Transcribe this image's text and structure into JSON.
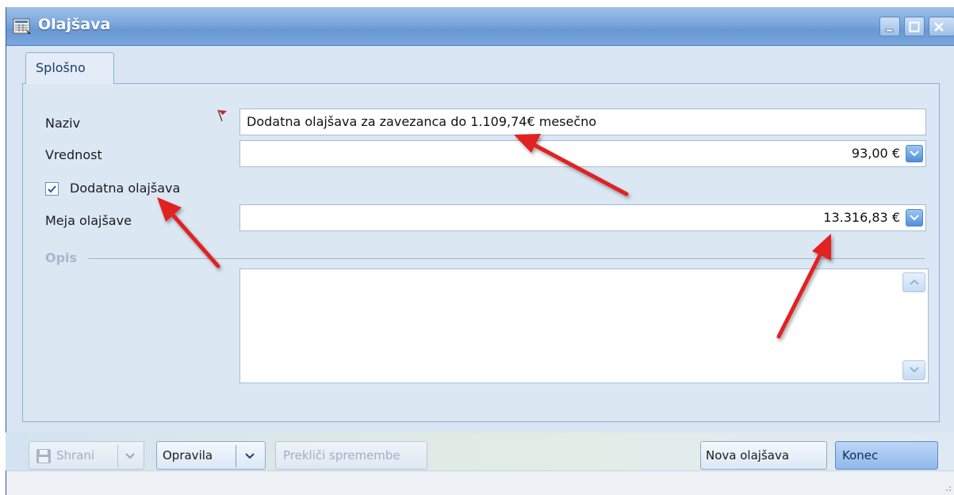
{
  "window": {
    "title": "Olajšava",
    "icon": "form-icon"
  },
  "tabs": [
    {
      "label": "Splošno",
      "active": true
    }
  ],
  "form": {
    "naziv_label": "Naziv",
    "naziv_value": "Dodatna olajšava za zavezanca do 1.109,74€ mesečno",
    "vrednost_label": "Vrednost",
    "vrednost_value": "93,00 €",
    "dodatna_label": "Dodatna olajšava",
    "dodatna_checked": true,
    "meja_label": "Meja olajšave",
    "meja_value": "13.316,83 €",
    "opis_label": "Opis",
    "opis_value": ""
  },
  "toolbar": {
    "save_label": "Shrani",
    "tasks_label": "Opravila",
    "cancel_changes_label": "Prekliči spremembe",
    "new_label": "Nova olajšava",
    "close_label": "Konec"
  },
  "colors": {
    "title_bar": "#7ea9dd",
    "panel": "#dce7f4",
    "annotation_arrow": "#e02020",
    "required_flag": "#c0282c"
  }
}
